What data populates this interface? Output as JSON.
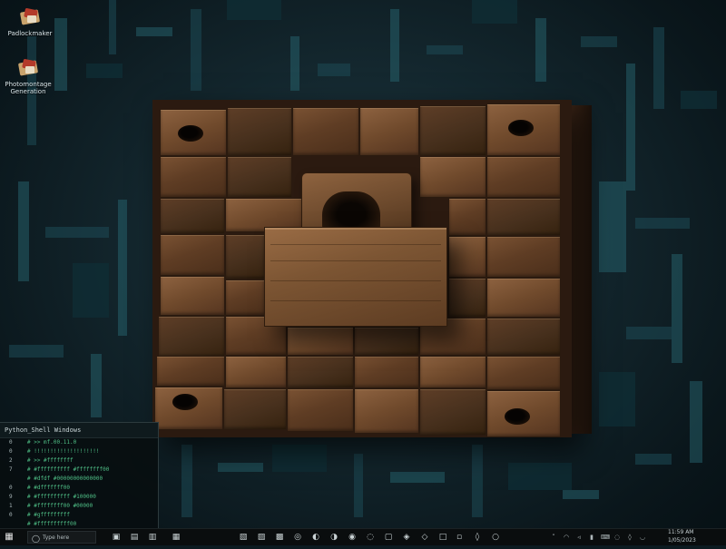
{
  "desktop": {
    "icons": [
      {
        "label": "Padlockmaker",
        "icon": "app-shortcut-icon"
      },
      {
        "label": "Photomontage Generation",
        "icon": "app-shortcut-icon"
      }
    ]
  },
  "terminal": {
    "title": "Python_Shell   Windows",
    "rows": [
      {
        "num": "0",
        "text": "# >> mf.00.11.0"
      },
      {
        "num": "0",
        "text": "# !!!!!!!!!!!!!!!!!!!!"
      },
      {
        "num": "2",
        "text": "# >> #ffffffff"
      },
      {
        "num": "7",
        "text": "# #ffffffffff #ffffffff00"
      },
      {
        "num": "",
        "text": "# #dfdf #00000000000000"
      },
      {
        "num": "0",
        "text": "# #dfffffff00"
      },
      {
        "num": "9",
        "text": "# #ffffffffff  #100000"
      },
      {
        "num": "1",
        "text": "# #ffffffff00  #00000"
      },
      {
        "num": "0",
        "text": "# #gfffffffff"
      },
      {
        "num": "",
        "text": "# #ffffffffff00"
      }
    ]
  },
  "taskbar": {
    "start_icon": "windows-start-icon",
    "search_label": "Type here",
    "pinned": [
      "task-view-icon",
      "file-explorer-icon",
      "browser-icon",
      "mail-icon",
      "store-icon",
      "terminal-icon",
      "photos-icon",
      "settings-icon",
      "music-icon",
      "folder-icon",
      "calendar-icon",
      "camera-icon",
      "notes-icon",
      "maps-icon",
      "weather-icon",
      "news-icon",
      "calculator-icon",
      "paint-icon",
      "mixer-icon"
    ],
    "tray_icons": [
      "chevron-up-icon",
      "network-icon",
      "volume-icon",
      "battery-icon",
      "keyboard-icon",
      "ink-icon",
      "bluetooth-icon",
      "cloud-icon"
    ],
    "time": "11:59 AM",
    "date": "1/05/2023"
  }
}
